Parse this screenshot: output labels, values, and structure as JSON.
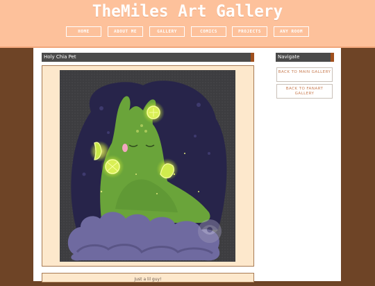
{
  "site": {
    "title": "TheMiles Art Gallery"
  },
  "nav": {
    "items": [
      "HOME",
      "ABOUT ME",
      "GALLERY",
      "COMICS",
      "PROJECTS",
      "ANY ROOM"
    ]
  },
  "post": {
    "title": "Holy Chia Pet",
    "caption": "Just a lil guy!"
  },
  "sidebar": {
    "heading": "Navigate",
    "buttons": [
      "BACK TO MAIN GALLERY",
      "BACK TO FANART GALLERY"
    ]
  },
  "colors": {
    "header": "#fdc19b",
    "background": "#6e4426",
    "panel": "#fde8cc",
    "heading_bar": "#4a4a4a",
    "heading_accent": "#a0501e",
    "link_text": "#c97f55"
  },
  "artwork": {
    "subject": "green chia-pet creature with glowing yellow bells on a cloud",
    "icons": [
      "sparkle-icon",
      "bell-icon"
    ]
  }
}
